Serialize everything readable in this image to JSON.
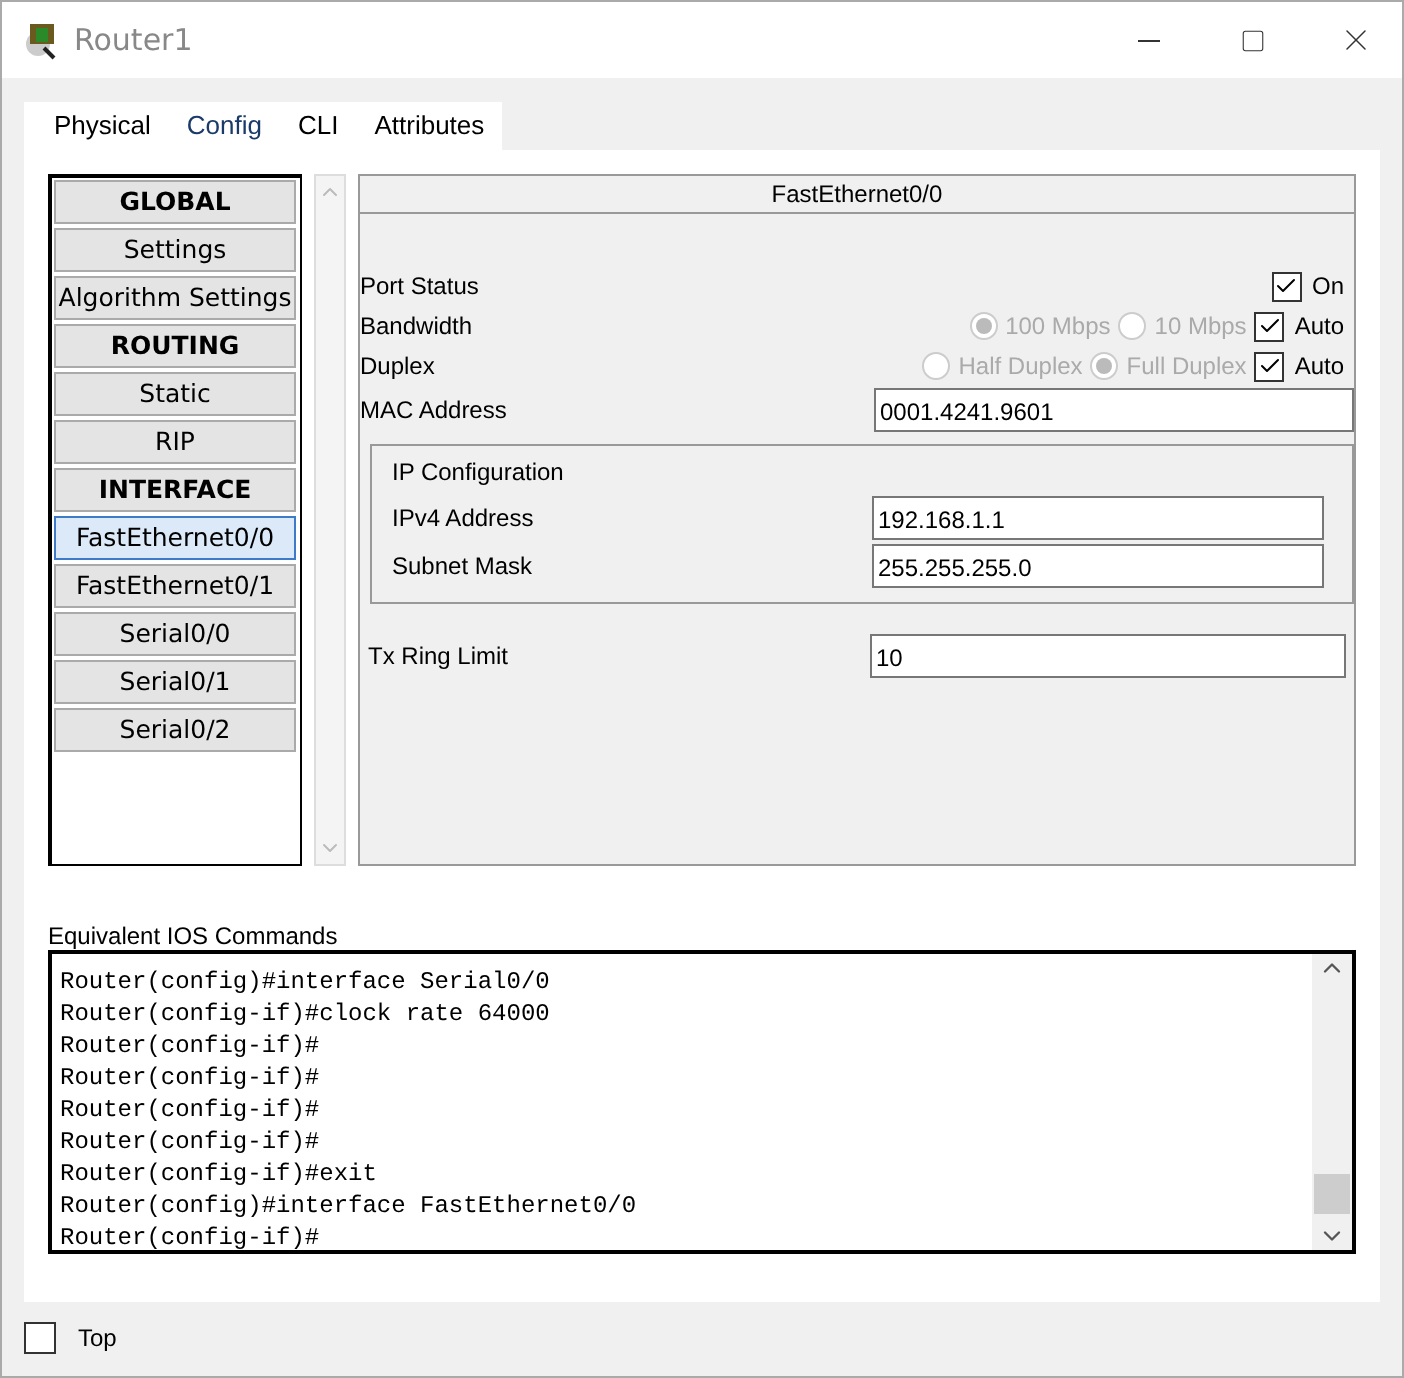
{
  "window": {
    "title": "Router1"
  },
  "tabs": [
    {
      "label": "Physical",
      "selected": false
    },
    {
      "label": "Config",
      "selected": true
    },
    {
      "label": "CLI",
      "selected": false
    },
    {
      "label": "Attributes",
      "selected": false
    }
  ],
  "sidebar": {
    "items": [
      {
        "kind": "header",
        "label": "GLOBAL",
        "selected": false
      },
      {
        "kind": "item",
        "label": "Settings",
        "selected": false
      },
      {
        "kind": "item",
        "label": "Algorithm Settings",
        "selected": false
      },
      {
        "kind": "header",
        "label": "ROUTING",
        "selected": false
      },
      {
        "kind": "item",
        "label": "Static",
        "selected": false
      },
      {
        "kind": "item",
        "label": "RIP",
        "selected": false
      },
      {
        "kind": "header",
        "label": "INTERFACE",
        "selected": false
      },
      {
        "kind": "item",
        "label": "FastEthernet0/0",
        "selected": true
      },
      {
        "kind": "item",
        "label": "FastEthernet0/1",
        "selected": false
      },
      {
        "kind": "item",
        "label": "Serial0/0",
        "selected": false
      },
      {
        "kind": "item",
        "label": "Serial0/1",
        "selected": false
      },
      {
        "kind": "item",
        "label": "Serial0/2",
        "selected": false
      }
    ]
  },
  "panel": {
    "title": "FastEthernet0/0",
    "port_status": {
      "label": "Port Status",
      "checkbox": {
        "label": "On",
        "checked": true
      }
    },
    "bandwidth": {
      "label": "Bandwidth",
      "options": [
        {
          "label": "100 Mbps",
          "selected": true,
          "disabled": true
        },
        {
          "label": "10 Mbps",
          "selected": false,
          "disabled": true
        }
      ],
      "auto": {
        "label": "Auto",
        "checked": true
      }
    },
    "duplex": {
      "label": "Duplex",
      "options": [
        {
          "label": "Half Duplex",
          "selected": false,
          "disabled": true
        },
        {
          "label": "Full Duplex",
          "selected": true,
          "disabled": true
        }
      ],
      "auto": {
        "label": "Auto",
        "checked": true
      }
    },
    "mac_address": {
      "label": "MAC Address",
      "value": "0001.4241.9601"
    },
    "ip_configuration": {
      "title": "IP Configuration",
      "fields": [
        {
          "label": "IPv4 Address",
          "value": "192.168.1.1"
        },
        {
          "label": "Subnet Mask",
          "value": "255.255.255.0"
        }
      ]
    },
    "tx_ring_limit": {
      "label": "Tx Ring Limit",
      "value": "10"
    }
  },
  "console": {
    "label": "Equivalent IOS Commands",
    "lines": [
      "Router(config)#interface Serial0/0",
      "Router(config-if)#clock rate 64000",
      "Router(config-if)#",
      "Router(config-if)#",
      "Router(config-if)#",
      "Router(config-if)#",
      "Router(config-if)#exit",
      "Router(config)#interface FastEthernet0/0",
      "Router(config-if)#"
    ]
  },
  "footer": {
    "top_checkbox": {
      "label": "Top",
      "checked": false
    }
  }
}
